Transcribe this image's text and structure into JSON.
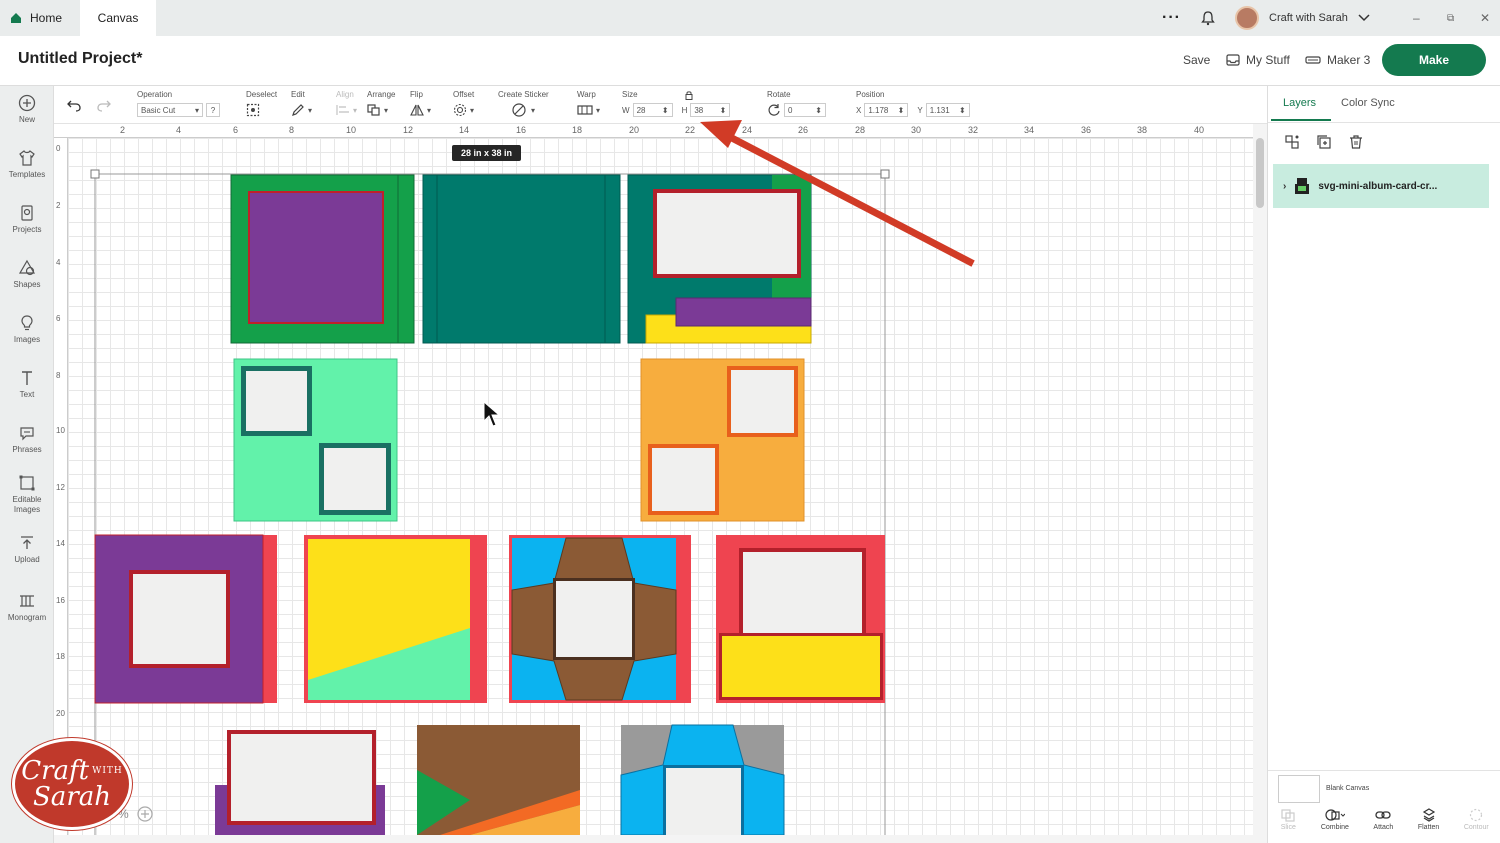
{
  "tabs": {
    "home": "Home",
    "canvas": "Canvas"
  },
  "account": {
    "name": "Craft with Sarah"
  },
  "project": {
    "title": "Untitled Project*",
    "save": "Save",
    "my_stuff": "My Stuff",
    "machine": "Maker 3",
    "make": "Make"
  },
  "sidebar": {
    "items": [
      {
        "label": "New",
        "icon": "plus-circle-icon"
      },
      {
        "label": "Templates",
        "icon": "shirt-icon"
      },
      {
        "label": "Projects",
        "icon": "projects-icon"
      },
      {
        "label": "Shapes",
        "icon": "shapes-icon"
      },
      {
        "label": "Images",
        "icon": "lightbulb-icon"
      },
      {
        "label": "Text",
        "icon": "text-icon"
      },
      {
        "label": "Phrases",
        "icon": "speech-bubble-icon"
      },
      {
        "label": "Editable Images",
        "icon": "editable-image-icon"
      },
      {
        "label": "Upload",
        "icon": "upload-icon"
      },
      {
        "label": "Monogram",
        "icon": "monogram-icon"
      }
    ]
  },
  "toolbar": {
    "operation_label": "Operation",
    "operation_value": "Basic Cut",
    "help": "?",
    "deselect": "Deselect",
    "edit": "Edit",
    "align": "Align",
    "arrange": "Arrange",
    "flip": "Flip",
    "offset": "Offset",
    "create_sticker": "Create Sticker",
    "warp": "Warp",
    "size": "Size",
    "w_label": "W",
    "w_value": "28",
    "h_label": "H",
    "h_value": "38",
    "rotate": "Rotate",
    "rotate_value": "0",
    "position": "Position",
    "x_label": "X",
    "x_value": "1.178",
    "y_label": "Y",
    "y_value": "1.131"
  },
  "ruler": {
    "top_ticks": [
      "2",
      "4",
      "6",
      "8",
      "10",
      "12",
      "14",
      "16",
      "18",
      "20",
      "22",
      "24",
      "26",
      "28",
      "30",
      "32",
      "34",
      "36",
      "38",
      "40"
    ],
    "left_ticks": [
      "0",
      "2",
      "4",
      "6",
      "8",
      "10",
      "12",
      "14",
      "16",
      "18",
      "20"
    ]
  },
  "tooltip": "28 in x 38 in",
  "panel": {
    "tab_layers": "Layers",
    "tab_color_sync": "Color Sync",
    "layer_name": "svg-mini-album-card-cr...",
    "blank_canvas": "Blank Canvas",
    "tools": [
      "Slice",
      "Combine",
      "Attach",
      "Flatten",
      "Contour"
    ]
  },
  "zoom_fragment": "%",
  "logo": {
    "line1": "Craft",
    "with": "WITH",
    "line2": "Sarah"
  },
  "colors": {
    "accent": "#147a4f",
    "green": "#14a04a",
    "teal": "#007a6c",
    "purple": "#7b3a96",
    "red": "#ef4450",
    "yellow": "#fde019",
    "mint": "#62f2aa",
    "orange": "#f7ad3e",
    "blue": "#0bb3f0",
    "brown": "#8b5a35",
    "gray": "#9a9a9a",
    "arrow": "#d13b26"
  }
}
